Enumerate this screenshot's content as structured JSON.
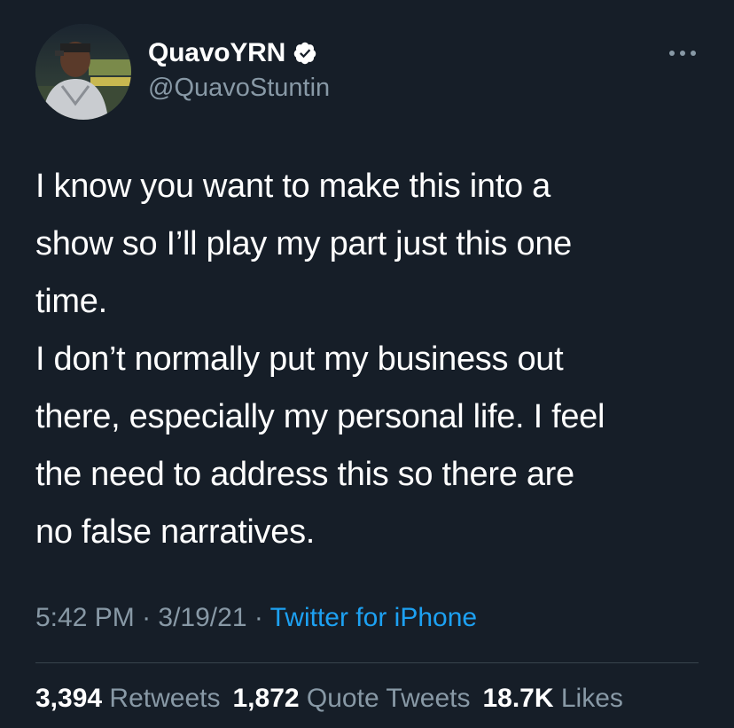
{
  "user": {
    "display_name": "QuavoYRN",
    "handle": "@QuavoStuntin",
    "verified_icon": "verified-badge-icon",
    "avatar_icon": "profile-photo"
  },
  "tweet": {
    "text": "I know you want to make this into a\nshow so I’ll play my part just this one\ntime.\nI don’t normally put my business out\nthere, especially my personal life. I feel\nthe need to address this so there are\nno false narratives."
  },
  "meta": {
    "time": "5:42 PM",
    "sep1": " · ",
    "date": "3/19/21",
    "sep2": " · ",
    "source": "Twitter for iPhone"
  },
  "stats": {
    "retweets_count": "3,394",
    "retweets_label": "Retweets",
    "quotes_count": "1,872",
    "quotes_label": "Quote Tweets",
    "likes_count": "18.7K",
    "likes_label": "Likes"
  },
  "colors": {
    "background": "#161e28",
    "primary_text": "#ffffff",
    "secondary_text": "#8899a6",
    "link": "#1da1f2",
    "divider": "#38444d"
  },
  "icons": {
    "more": "more-options-icon"
  }
}
